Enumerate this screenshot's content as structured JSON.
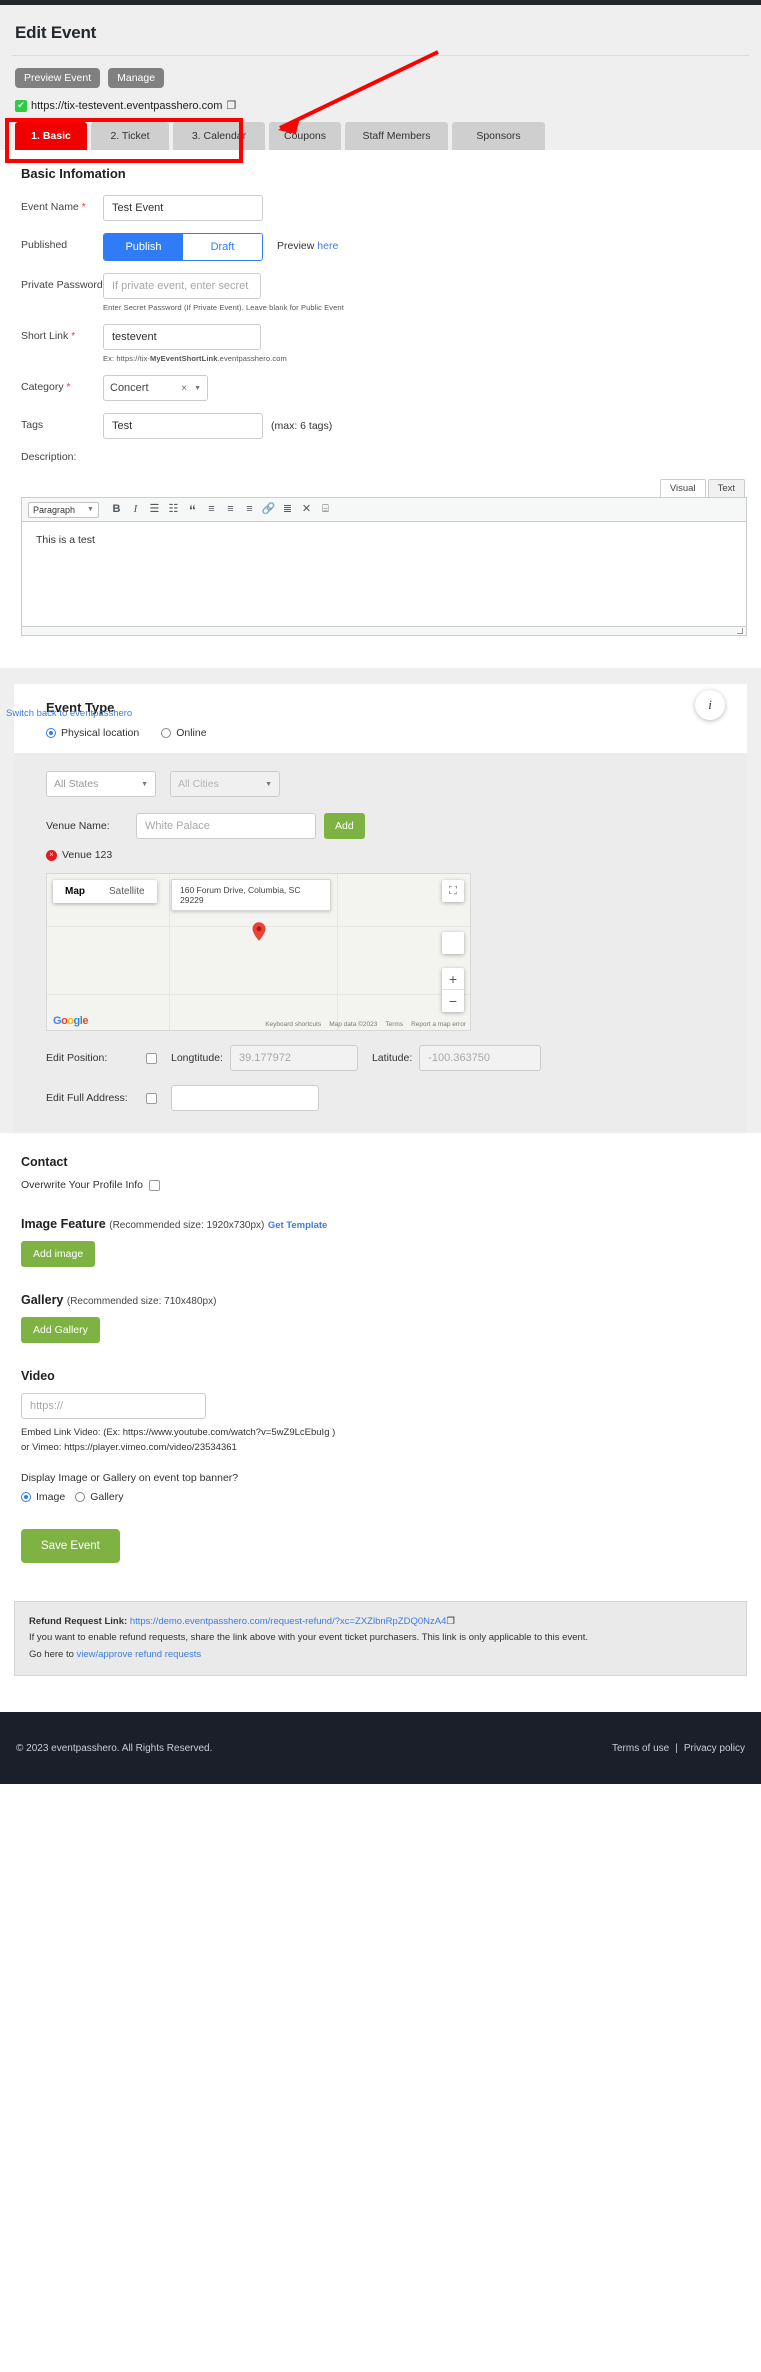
{
  "header": {
    "title": "Edit Event",
    "preview_event_label": "Preview Event",
    "manage_label": "Manage",
    "event_url": "https://tix-testevent.eventpasshero.com",
    "check_glyph": "✔",
    "copy_glyph": "❐"
  },
  "tabs": [
    {
      "label": "1. Basic",
      "active": true
    },
    {
      "label": "2. Ticket",
      "active": false
    },
    {
      "label": "3. Calendar",
      "active": false
    },
    {
      "label": "Coupons",
      "active": false
    },
    {
      "label": "Staff Members",
      "active": false
    },
    {
      "label": "Sponsors",
      "active": false
    }
  ],
  "basic": {
    "section_title": "Basic Infomation",
    "event_name_label": "Event Name",
    "event_name_value": "Test Event",
    "published_label": "Published",
    "publish_label": "Publish",
    "draft_label": "Draft",
    "preview_prefix": "Preview ",
    "preview_link": "here",
    "private_password_label": "Private Password",
    "private_password_placeholder": "If private event, enter secret password",
    "private_password_hint": "Enter Secret Password (If Private Event). Leave blank for Public Event",
    "short_link_label": "Short Link",
    "short_link_value": "testevent",
    "short_link_hint_pre": "Ex: https://tix-",
    "short_link_hint_bold": "MyEventShortLink",
    "short_link_hint_post": ".eventpasshero.com",
    "category_label": "Category",
    "category_value": "Concert",
    "category_clear": "×",
    "tags_label": "Tags",
    "tags_value": "Test",
    "tags_max": "(max: 6 tags)",
    "description_label": "Description:"
  },
  "editor": {
    "visual_tab": "Visual",
    "text_tab": "Text",
    "format_select": "Paragraph",
    "toolbar_icons": [
      {
        "name": "bold-icon",
        "glyph": "B"
      },
      {
        "name": "italic-icon",
        "glyph": "I"
      },
      {
        "name": "bullet-list-icon",
        "glyph": "☰"
      },
      {
        "name": "numbered-list-icon",
        "glyph": "☷"
      },
      {
        "name": "blockquote-icon",
        "glyph": "“"
      },
      {
        "name": "align-left-icon",
        "glyph": "≡"
      },
      {
        "name": "align-center-icon",
        "glyph": "≡"
      },
      {
        "name": "align-right-icon",
        "glyph": "≡"
      },
      {
        "name": "insert-link-icon",
        "glyph": "🔗"
      },
      {
        "name": "read-more-icon",
        "glyph": "≣"
      },
      {
        "name": "fullscreen-icon",
        "glyph": "✕"
      },
      {
        "name": "toolbar-toggle-icon",
        "glyph": "⌸"
      }
    ],
    "content": "This is a test"
  },
  "event_type": {
    "title": "Event Type",
    "switch_back_link": "Switch back to eventpasshero",
    "info_glyph": "i",
    "physical_label": "Physical location",
    "online_label": "Online",
    "selected": "physical"
  },
  "location": {
    "state_placeholder": "All States",
    "city_placeholder": "All Cities",
    "venue_name_label": "Venue Name:",
    "venue_name_placeholder": "White Palace",
    "add_label": "Add",
    "venue_chip": "Venue 123",
    "venue_chip_remove": "×",
    "map_tab": "Map",
    "satellite_tab": "Satellite",
    "address": "160 Forum Drive, Columbia, SC 29229",
    "google_letters": [
      "G",
      "o",
      "o",
      "g",
      "l",
      "e"
    ],
    "map_footer": [
      "Keyboard shortcuts",
      "Map data ©2023",
      "Terms",
      "Report a map error"
    ],
    "fullscreen_glyph": "⛶",
    "zoom_in_glyph": "+",
    "zoom_out_glyph": "−",
    "edit_position_label": "Edit Position:",
    "longitude_label": "Longtitude:",
    "longitude_value": "39.177972",
    "latitude_label": "Latitude:",
    "latitude_value": "-100.363750",
    "edit_full_address_label": "Edit Full Address:"
  },
  "contact": {
    "title": "Contact",
    "overwrite_label": "Overwrite Your Profile Info"
  },
  "media": {
    "image_feature_title": "Image Feature",
    "image_feature_sub": "(Recommended size: 1920x730px)",
    "get_template_link": "Get Template",
    "add_image_label": "Add image",
    "gallery_title": "Gallery",
    "gallery_sub": "(Recommended size: 710x480px)",
    "add_gallery_label": "Add Gallery",
    "video_title": "Video",
    "video_placeholder": "https://",
    "video_note_1": "Embed Link Video: (Ex: https://www.youtube.com/watch?v=5wZ9LcEbuIg )",
    "video_note_2": "or Vimeo: https://player.vimeo.com/video/23534361",
    "display_question": "Display Image or Gallery on event top banner?",
    "display_image_label": "Image",
    "display_gallery_label": "Gallery",
    "display_selected": "image"
  },
  "save": {
    "label": "Save Event"
  },
  "refund": {
    "label": "Refund Request Link:",
    "link": "https://demo.eventpasshero.com/request-refund/?xc=ZXZlbnRpZDQ0NzA4",
    "copy_glyph": "❐",
    "line2": "If you want to enable refund requests, share the link above with your event ticket purchasers. This link is only applicable to this event.",
    "line3_pre": "Go here to ",
    "line3_link": "view/approve refund requests"
  },
  "footer": {
    "copyright": "© 2023 eventpasshero. All Rights Reserved.",
    "terms": "Terms of use",
    "privacy": "Privacy policy",
    "separator": "|"
  },
  "colors": {
    "accent_red": "#f00000",
    "primary_blue": "#2f7cf6",
    "green": "#7eb343",
    "footer_bg": "#1b1f2a"
  }
}
